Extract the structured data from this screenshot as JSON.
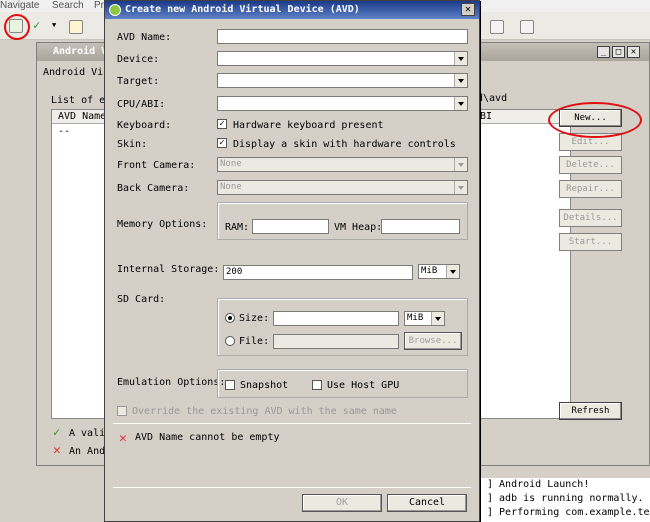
{
  "menubar": {
    "items": [
      "Navigate",
      "Search",
      "Pr"
    ]
  },
  "bg_window": {
    "title": "Android V",
    "tab": "Android Vir",
    "list_label": "List of ex",
    "col_avd_name": "AVD Name",
    "empty_row": "--",
    "path_fragment": "d\\avd",
    "col_abi": "BI",
    "buttons": {
      "new": "New...",
      "edit": "Edit...",
      "delete": "Delete...",
      "repair": "Repair...",
      "details": "Details...",
      "start": "Start...",
      "refresh": "Refresh"
    },
    "legend_valid": "A valic",
    "legend_error": "An Andr"
  },
  "console": {
    "lines": [
      "] Android Launch!",
      "] adb is running normally.",
      "] Performing com.example.tes"
    ]
  },
  "dialog": {
    "title": "Create new Android Virtual Device (AVD)",
    "labels": {
      "avd_name": "AVD Name:",
      "device": "Device:",
      "target": "Target:",
      "cpu_abi": "CPU/ABI:",
      "keyboard": "Keyboard:",
      "skin": "Skin:",
      "front_camera": "Front Camera:",
      "back_camera": "Back Camera:",
      "memory_options": "Memory Options:",
      "internal_storage": "Internal Storage:",
      "sd_card": "SD Card:",
      "emulation_options": "Emulation Options:"
    },
    "keyboard_check": "Hardware keyboard present",
    "skin_check": "Display a skin with hardware controls",
    "front_camera_value": "None",
    "back_camera_value": "None",
    "ram_label": "RAM:",
    "vm_heap_label": "VM Heap:",
    "internal_storage_value": "200",
    "internal_storage_unit": "MiB",
    "size_label": "Size:",
    "size_unit": "MiB",
    "file_label": "File:",
    "browse": "Browse...",
    "snapshot": "Snapshot",
    "use_host_gpu": "Use Host GPU",
    "override": "Override the existing AVD with the same name",
    "error_msg": "AVD Name cannot be empty",
    "ok": "OK",
    "cancel": "Cancel"
  },
  "colors": {
    "title_gradient_start": "#1b3a8a",
    "highlight_circle": "#e01010"
  }
}
